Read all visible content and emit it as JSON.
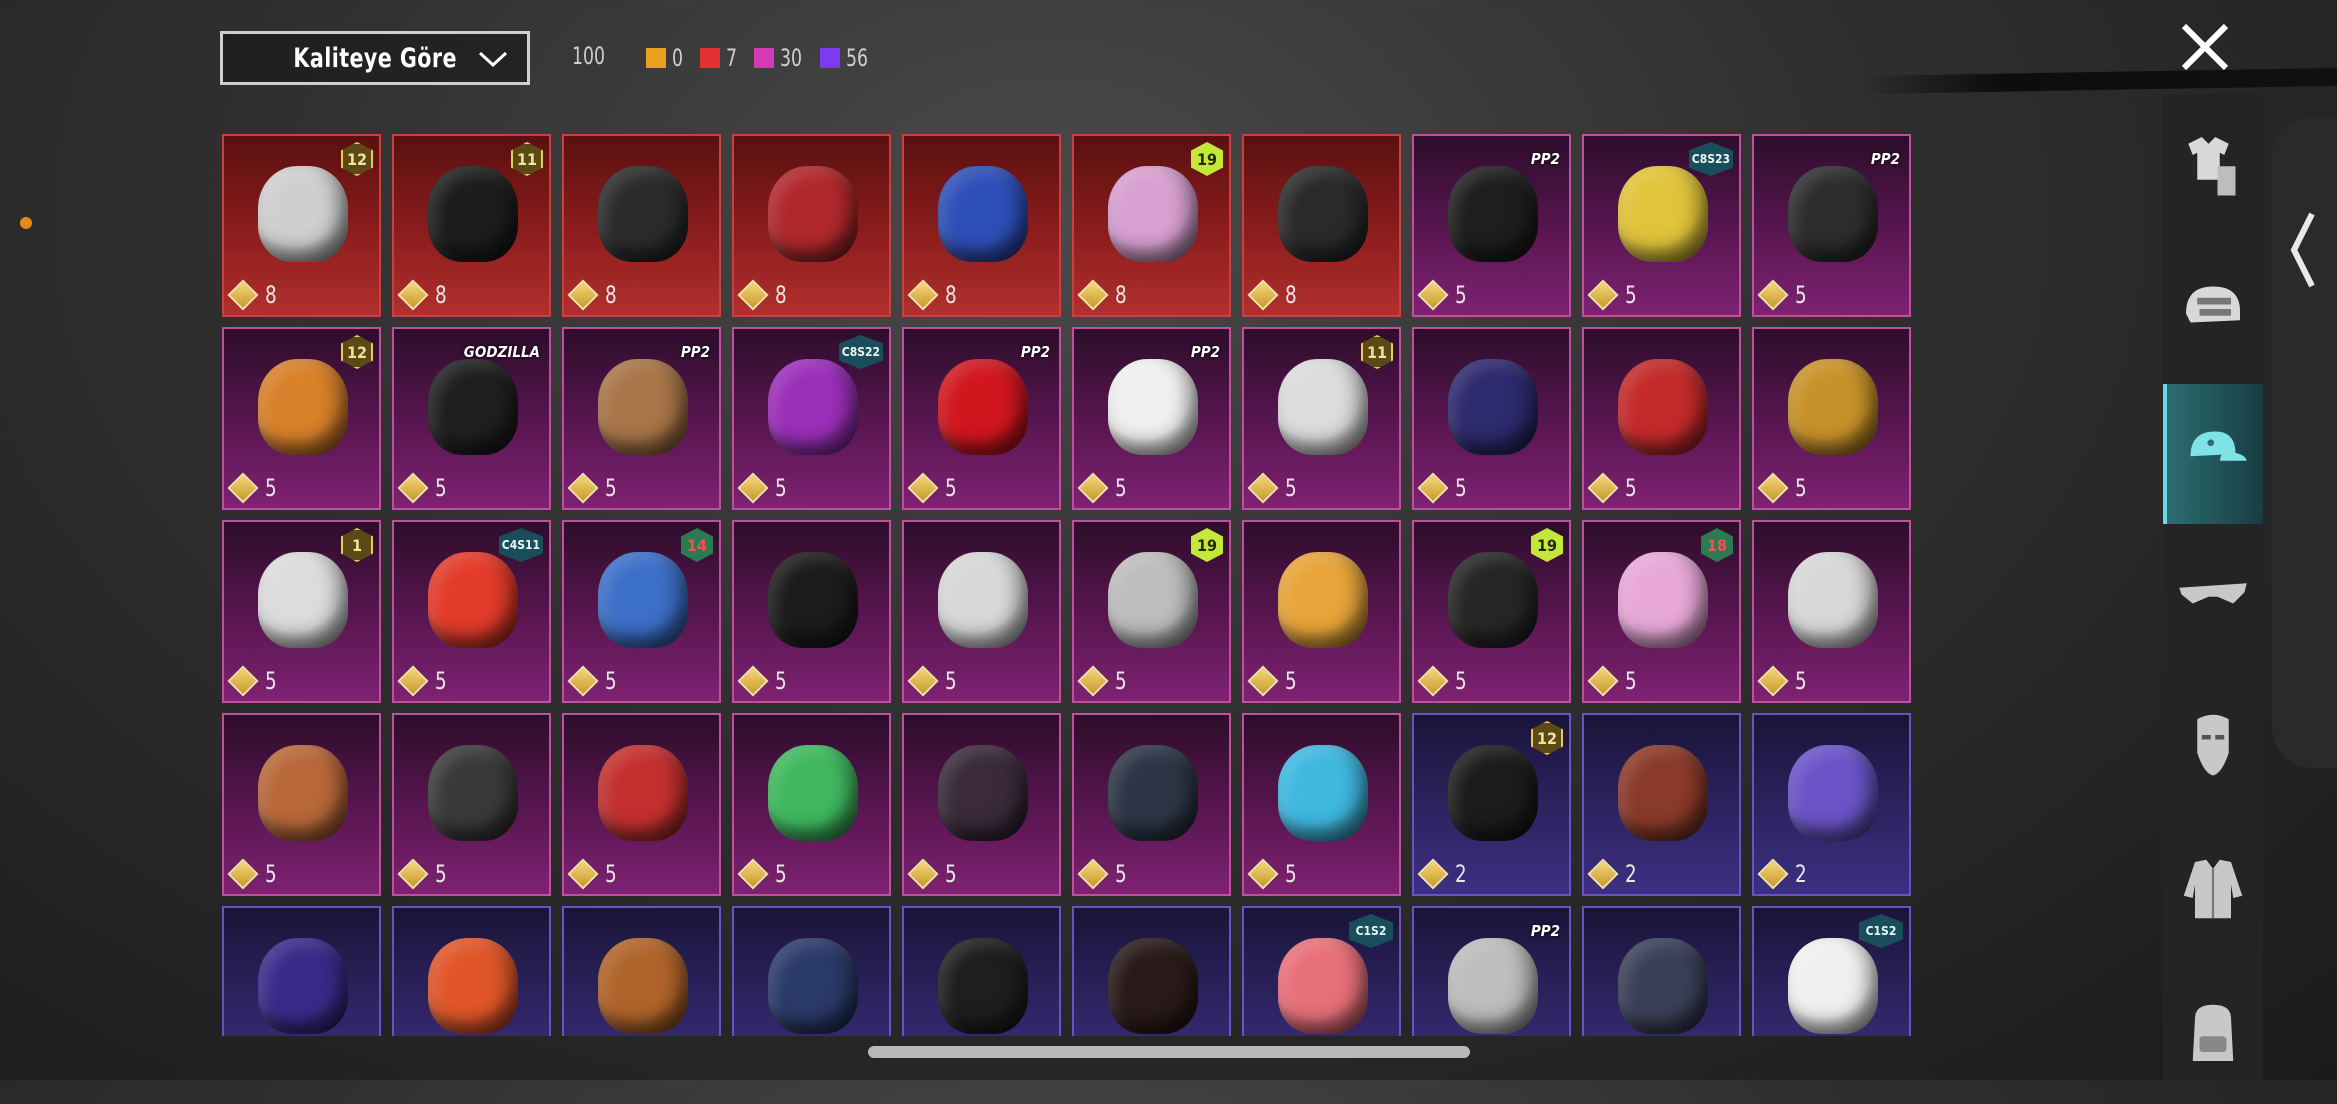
{
  "toolbar": {
    "sort_label": "Kaliteye Göre",
    "total_count": "100",
    "quality_counts": [
      {
        "color": "#e8a21c",
        "count": "0"
      },
      {
        "color": "#e23232",
        "count": "7"
      },
      {
        "color": "#d43ab4",
        "count": "30"
      },
      {
        "color": "#7b3cf0",
        "count": "56"
      }
    ]
  },
  "items": [
    {
      "tier": "red",
      "count": "8",
      "badge": "12",
      "badge_style": "gold",
      "art": "#cfcfcf"
    },
    {
      "tier": "red",
      "count": "8",
      "badge": "11",
      "badge_style": "gold",
      "art": "#1d1d1d"
    },
    {
      "tier": "red",
      "count": "8",
      "badge": "",
      "badge_style": "",
      "art": "#2b2b2b"
    },
    {
      "tier": "red",
      "count": "8",
      "badge": "",
      "badge_style": "",
      "art": "#b0282c"
    },
    {
      "tier": "red",
      "count": "8",
      "badge": "",
      "badge_style": "",
      "art": "#2e4fb8"
    },
    {
      "tier": "red",
      "count": "8",
      "badge": "19",
      "badge_style": "lime",
      "art": "#d7a0d0"
    },
    {
      "tier": "red",
      "count": "8",
      "badge": "",
      "badge_style": "",
      "art": "#2a2a2a"
    },
    {
      "tier": "pink",
      "count": "5",
      "badge": "PP2",
      "badge_style": "text",
      "art": "#1e1e1e"
    },
    {
      "tier": "pink",
      "count": "5",
      "badge": "C8S23",
      "badge_style": "teal",
      "art": "#e0c43a"
    },
    {
      "tier": "pink",
      "count": "5",
      "badge": "PP2",
      "badge_style": "text",
      "art": "#2d2d2d"
    },
    {
      "tier": "pink",
      "count": "5",
      "badge": "12",
      "badge_style": "gold",
      "art": "#d8802a"
    },
    {
      "tier": "pink",
      "count": "5",
      "badge": "GODZILLA",
      "badge_style": "text",
      "art": "#1f1f1f"
    },
    {
      "tier": "pink",
      "count": "5",
      "badge": "PP2",
      "badge_style": "text",
      "art": "#a87548"
    },
    {
      "tier": "pink",
      "count": "5",
      "badge": "C8S22",
      "badge_style": "teal",
      "art": "#9a2fb8"
    },
    {
      "tier": "pink",
      "count": "5",
      "badge": "PP2",
      "badge_style": "text",
      "art": "#d1161e"
    },
    {
      "tier": "pink",
      "count": "5",
      "badge": "PP2",
      "badge_style": "text",
      "art": "#efefef"
    },
    {
      "tier": "pink",
      "count": "5",
      "badge": "11",
      "badge_style": "gold",
      "art": "#dcdcdc"
    },
    {
      "tier": "pink",
      "count": "5",
      "badge": "",
      "badge_style": "",
      "art": "#2d2a6e"
    },
    {
      "tier": "pink",
      "count": "5",
      "badge": "",
      "badge_style": "",
      "art": "#c42a2a"
    },
    {
      "tier": "pink",
      "count": "5",
      "badge": "",
      "badge_style": "",
      "art": "#c8922a"
    },
    {
      "tier": "pink",
      "count": "5",
      "badge": "1",
      "badge_style": "gold",
      "art": "#dcdcdc"
    },
    {
      "tier": "pink",
      "count": "5",
      "badge": "C4S11",
      "badge_style": "teal",
      "art": "#e33b2a"
    },
    {
      "tier": "pink",
      "count": "5",
      "badge": "14",
      "badge_style": "red18",
      "art": "#3c6fc8"
    },
    {
      "tier": "pink",
      "count": "5",
      "badge": "",
      "badge_style": "",
      "art": "#1c1c1c"
    },
    {
      "tier": "pink",
      "count": "5",
      "badge": "",
      "badge_style": "",
      "art": "#d8d8d8"
    },
    {
      "tier": "pink",
      "count": "5",
      "badge": "19",
      "badge_style": "lime",
      "art": "#bdbdbd"
    },
    {
      "tier": "pink",
      "count": "5",
      "badge": "",
      "badge_style": "",
      "art": "#e8a43a"
    },
    {
      "tier": "pink",
      "count": "5",
      "badge": "19",
      "badge_style": "lime",
      "art": "#262626"
    },
    {
      "tier": "pink",
      "count": "5",
      "badge": "18",
      "badge_style": "red18",
      "art": "#e8a8d8"
    },
    {
      "tier": "pink",
      "count": "5",
      "badge": "",
      "badge_style": "",
      "art": "#d8d8d8"
    },
    {
      "tier": "pink",
      "count": "5",
      "badge": "",
      "badge_style": "",
      "art": "#b8683a"
    },
    {
      "tier": "pink",
      "count": "5",
      "badge": "",
      "badge_style": "",
      "art": "#3a3a3a"
    },
    {
      "tier": "pink",
      "count": "5",
      "badge": "",
      "badge_style": "",
      "art": "#c43030"
    },
    {
      "tier": "pink",
      "count": "5",
      "badge": "",
      "badge_style": "",
      "art": "#3fb860"
    },
    {
      "tier": "pink",
      "count": "5",
      "badge": "",
      "badge_style": "",
      "art": "#3a2a3a"
    },
    {
      "tier": "pink",
      "count": "5",
      "badge": "",
      "badge_style": "",
      "art": "#2d3646"
    },
    {
      "tier": "pink",
      "count": "5",
      "badge": "",
      "badge_style": "",
      "art": "#3fb8e0"
    },
    {
      "tier": "purple",
      "count": "2",
      "badge": "12",
      "badge_style": "gold",
      "art": "#1c1c1c"
    },
    {
      "tier": "purple",
      "count": "2",
      "badge": "",
      "badge_style": "",
      "art": "#8a3a2a"
    },
    {
      "tier": "purple",
      "count": "2",
      "badge": "",
      "badge_style": "",
      "art": "#6a54c8"
    },
    {
      "tier": "purple",
      "count": "",
      "badge": "",
      "badge_style": "",
      "art": "#3a2a8a"
    },
    {
      "tier": "purple",
      "count": "",
      "badge": "",
      "badge_style": "",
      "art": "#e0562a"
    },
    {
      "tier": "purple",
      "count": "",
      "badge": "",
      "badge_style": "",
      "art": "#b0642a"
    },
    {
      "tier": "purple",
      "count": "",
      "badge": "",
      "badge_style": "",
      "art": "#2a3a6a"
    },
    {
      "tier": "purple",
      "count": "",
      "badge": "",
      "badge_style": "",
      "art": "#1e1e1e"
    },
    {
      "tier": "purple",
      "count": "",
      "badge": "",
      "badge_style": "",
      "art": "#2a1a1a"
    },
    {
      "tier": "purple",
      "count": "",
      "badge": "C1S2",
      "badge_style": "teal",
      "art": "#e8707a"
    },
    {
      "tier": "purple",
      "count": "",
      "badge": "PP2",
      "badge_style": "text",
      "art": "#bdbdbd"
    },
    {
      "tier": "purple",
      "count": "",
      "badge": "",
      "badge_style": "",
      "art": "#3a4058"
    },
    {
      "tier": "purple",
      "count": "",
      "badge": "C1S2",
      "badge_style": "teal",
      "art": "#f0f0f0"
    }
  ],
  "sidebar": {
    "categories": [
      {
        "icon": "outfit-icon",
        "active": false
      },
      {
        "icon": "helmet-icon",
        "active": false
      },
      {
        "icon": "hat-icon",
        "active": true
      },
      {
        "icon": "glasses-icon",
        "active": false
      },
      {
        "icon": "mask-icon",
        "active": false
      },
      {
        "icon": "jacket-icon",
        "active": false
      },
      {
        "icon": "backpack-icon",
        "active": false
      }
    ]
  }
}
